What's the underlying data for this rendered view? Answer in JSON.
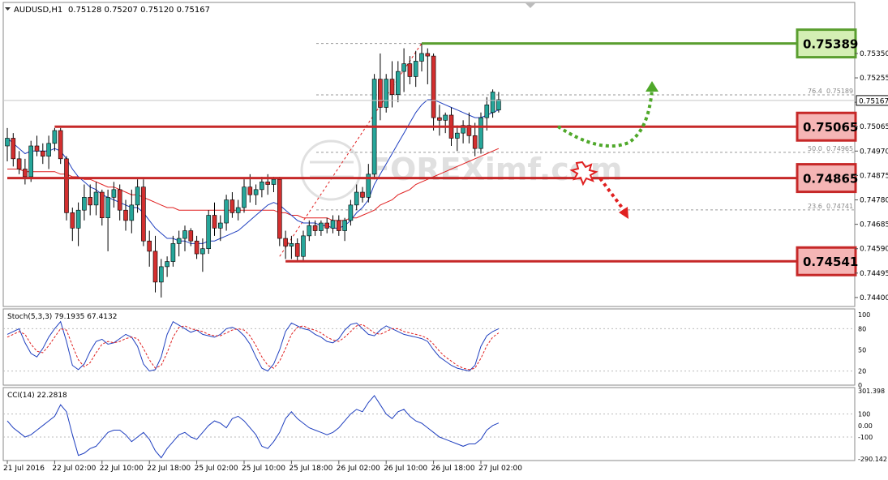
{
  "header": {
    "symbol": "AUDUSD,H1",
    "ohlc": "0.75128 0.75207 0.75120 0.75167"
  },
  "watermark": "FOREXimf.com",
  "colors": {
    "bull": "#26a69a",
    "bear": "#d32f2f",
    "ma_fast": "#1f3fbf",
    "ma_slow": "#e02020",
    "level_red": "#c62828",
    "level_green": "#5a9e2f"
  },
  "price_axis": {
    "ylim": [
      0.74365,
      0.75495
    ],
    "ticks": [
      "0.75350",
      "0.75255",
      "0.75160",
      "0.75065",
      "0.74970",
      "0.74875",
      "0.74780",
      "0.74685",
      "0.74590",
      "0.74495",
      "0.74400"
    ],
    "tick_values": [
      0.7535,
      0.75255,
      0.7516,
      0.75065,
      0.7497,
      0.74875,
      0.7478,
      0.74685,
      0.7459,
      0.74495,
      0.744
    ],
    "current_price": "0.75167"
  },
  "time_axis": {
    "labels": [
      "21 Jul 2016",
      "22 Jul 02:00",
      "22 Jul 10:00",
      "22 Jul 18:00",
      "25 Jul 02:00",
      "25 Jul 10:00",
      "25 Jul 18:00",
      "26 Jul 02:00",
      "26 Jul 10:00",
      "26 Jul 18:00",
      "27 Jul 02:00"
    ],
    "label_index": [
      0,
      8,
      16,
      24,
      32,
      40,
      48,
      56,
      64,
      72,
      80
    ]
  },
  "levels": [
    {
      "label": "0.75389",
      "value": 0.75389,
      "color": "green",
      "start": 70
    },
    {
      "label": "0.75065",
      "value": 0.75065,
      "color": "red",
      "start": 8
    },
    {
      "label": "0.74865",
      "value": 0.74865,
      "color": "red",
      "start": 0
    },
    {
      "label": "0.74541",
      "value": 0.74541,
      "color": "red",
      "start": 47
    }
  ],
  "fib": [
    {
      "label": "76.4",
      "value": "0.75189",
      "level": 0.75189
    },
    {
      "label": "50.0",
      "value": "0.74965",
      "level": 0.74965
    },
    {
      "label": "23.6",
      "value": "0.74741",
      "level": 0.74741
    }
  ],
  "chart_data": {
    "type": "candlestick",
    "ylim": [
      0.74365,
      0.75495
    ],
    "candles": [
      [
        0.7499,
        0.7506,
        0.7493,
        0.7502
      ],
      [
        0.7502,
        0.7504,
        0.7491,
        0.7494
      ],
      [
        0.7494,
        0.7497,
        0.7488,
        0.749
      ],
      [
        0.749,
        0.7494,
        0.7484,
        0.7487
      ],
      [
        0.7487,
        0.7501,
        0.7485,
        0.7499
      ],
      [
        0.7499,
        0.7503,
        0.7495,
        0.7497
      ],
      [
        0.7497,
        0.75,
        0.7492,
        0.7495
      ],
      [
        0.7495,
        0.7503,
        0.749,
        0.75
      ],
      [
        0.75,
        0.7506,
        0.7497,
        0.7505
      ],
      [
        0.7505,
        0.7506,
        0.7492,
        0.7494
      ],
      [
        0.7494,
        0.7495,
        0.747,
        0.7473
      ],
      [
        0.7473,
        0.7475,
        0.7462,
        0.7467
      ],
      [
        0.7467,
        0.7477,
        0.746,
        0.7474
      ],
      [
        0.7474,
        0.7484,
        0.747,
        0.7479
      ],
      [
        0.7479,
        0.7484,
        0.7472,
        0.7476
      ],
      [
        0.7476,
        0.7485,
        0.7472,
        0.7481
      ],
      [
        0.7481,
        0.7482,
        0.7468,
        0.7471
      ],
      [
        0.7471,
        0.7482,
        0.7458,
        0.7479
      ],
      [
        0.7479,
        0.7485,
        0.7475,
        0.7482
      ],
      [
        0.7482,
        0.7484,
        0.747,
        0.7474
      ],
      [
        0.7474,
        0.7478,
        0.7466,
        0.747
      ],
      [
        0.747,
        0.7482,
        0.7465,
        0.7476
      ],
      [
        0.7476,
        0.7486,
        0.7473,
        0.7483
      ],
      [
        0.7483,
        0.7486,
        0.746,
        0.7462
      ],
      [
        0.7462,
        0.7466,
        0.7452,
        0.7458
      ],
      [
        0.7458,
        0.7464,
        0.7442,
        0.7446
      ],
      [
        0.7446,
        0.7455,
        0.744,
        0.7452
      ],
      [
        0.7452,
        0.7456,
        0.7448,
        0.7454
      ],
      [
        0.7454,
        0.7464,
        0.7452,
        0.7461
      ],
      [
        0.7461,
        0.7466,
        0.7456,
        0.7463
      ],
      [
        0.7463,
        0.7468,
        0.7458,
        0.7466
      ],
      [
        0.7466,
        0.7467,
        0.746,
        0.7462
      ],
      [
        0.7462,
        0.7464,
        0.7455,
        0.7457
      ],
      [
        0.7457,
        0.7463,
        0.745,
        0.7459
      ],
      [
        0.7459,
        0.7474,
        0.7457,
        0.7472
      ],
      [
        0.7472,
        0.7477,
        0.7464,
        0.7467
      ],
      [
        0.7467,
        0.7472,
        0.7462,
        0.7469
      ],
      [
        0.7469,
        0.748,
        0.7466,
        0.7478
      ],
      [
        0.7478,
        0.7481,
        0.7471,
        0.7473
      ],
      [
        0.7473,
        0.7478,
        0.747,
        0.7475
      ],
      [
        0.7475,
        0.7486,
        0.7473,
        0.7483
      ],
      [
        0.7483,
        0.7488,
        0.7477,
        0.748
      ],
      [
        0.748,
        0.7484,
        0.7476,
        0.7482
      ],
      [
        0.7482,
        0.7487,
        0.7479,
        0.7485
      ],
      [
        0.7485,
        0.7488,
        0.748,
        0.7484
      ],
      [
        0.7484,
        0.7487,
        0.7481,
        0.7486
      ],
      [
        0.7486,
        0.7487,
        0.746,
        0.7463
      ],
      [
        0.7463,
        0.7466,
        0.7455,
        0.746
      ],
      [
        0.746,
        0.7464,
        0.7455,
        0.7461
      ],
      [
        0.7461,
        0.7463,
        0.7454,
        0.7456
      ],
      [
        0.7456,
        0.7466,
        0.7454,
        0.7464
      ],
      [
        0.7464,
        0.747,
        0.7462,
        0.7468
      ],
      [
        0.7468,
        0.747,
        0.7464,
        0.7466
      ],
      [
        0.7466,
        0.747,
        0.7464,
        0.7469
      ],
      [
        0.7469,
        0.7471,
        0.7465,
        0.7467
      ],
      [
        0.7467,
        0.7472,
        0.7465,
        0.747
      ],
      [
        0.747,
        0.7472,
        0.7464,
        0.7466
      ],
      [
        0.7466,
        0.7471,
        0.7462,
        0.747
      ],
      [
        0.747,
        0.7478,
        0.7468,
        0.7476
      ],
      [
        0.7476,
        0.7484,
        0.7474,
        0.7481
      ],
      [
        0.7481,
        0.7483,
        0.7477,
        0.7479
      ],
      [
        0.7479,
        0.7492,
        0.7477,
        0.7488
      ],
      [
        0.7488,
        0.7527,
        0.7486,
        0.7525
      ],
      [
        0.7525,
        0.7535,
        0.7509,
        0.7514
      ],
      [
        0.7514,
        0.7527,
        0.7512,
        0.7525
      ],
      [
        0.7525,
        0.7532,
        0.7514,
        0.7519
      ],
      [
        0.7519,
        0.7532,
        0.7516,
        0.7528
      ],
      [
        0.7528,
        0.7537,
        0.752,
        0.7531
      ],
      [
        0.7531,
        0.7534,
        0.7523,
        0.7526
      ],
      [
        0.7526,
        0.7536,
        0.7522,
        0.7532
      ],
      [
        0.7532,
        0.7539,
        0.7528,
        0.7535
      ],
      [
        0.7535,
        0.7537,
        0.7523,
        0.7534
      ],
      [
        0.7534,
        0.7535,
        0.7505,
        0.751
      ],
      [
        0.751,
        0.7515,
        0.7503,
        0.7509
      ],
      [
        0.7509,
        0.7512,
        0.7504,
        0.7511
      ],
      [
        0.7511,
        0.7514,
        0.7499,
        0.7502
      ],
      [
        0.7502,
        0.7507,
        0.7497,
        0.7504
      ],
      [
        0.7504,
        0.7509,
        0.75,
        0.7507
      ],
      [
        0.7507,
        0.7512,
        0.75,
        0.7503
      ],
      [
        0.7503,
        0.7508,
        0.7495,
        0.7498
      ],
      [
        0.7498,
        0.7512,
        0.7496,
        0.751
      ],
      [
        0.751,
        0.7518,
        0.7505,
        0.7515
      ],
      [
        0.7512,
        0.7521,
        0.751,
        0.752
      ],
      [
        0.7513,
        0.752,
        0.7512,
        0.7517
      ]
    ],
    "ma_fast": [
      0.7502,
      0.75,
      0.7498,
      0.7496,
      0.7497,
      0.7497,
      0.7497,
      0.7497,
      0.7498,
      0.7497,
      0.7494,
      0.749,
      0.7487,
      0.7485,
      0.7483,
      0.7482,
      0.748,
      0.7479,
      0.7478,
      0.7477,
      0.7476,
      0.7475,
      0.7475,
      0.7473,
      0.747,
      0.7467,
      0.7465,
      0.7463,
      0.7463,
      0.7462,
      0.7462,
      0.7461,
      0.7461,
      0.7461,
      0.7462,
      0.7462,
      0.7463,
      0.7464,
      0.7465,
      0.7466,
      0.7468,
      0.747,
      0.7472,
      0.7474,
      0.7476,
      0.7477,
      0.7476,
      0.7474,
      0.7472,
      0.747,
      0.7469,
      0.7469,
      0.7469,
      0.7468,
      0.7468,
      0.7467,
      0.7467,
      0.7468,
      0.747,
      0.7473,
      0.7475,
      0.7478,
      0.7484,
      0.7488,
      0.7492,
      0.7496,
      0.75,
      0.7504,
      0.7508,
      0.7512,
      0.7515,
      0.7517,
      0.7517,
      0.7516,
      0.7515,
      0.7514,
      0.7513,
      0.7512,
      0.7511,
      0.751,
      0.751,
      0.7511,
      0.7512,
      0.7513
    ],
    "ma_slow": [
      0.749,
      0.749,
      0.749,
      0.7489,
      0.7489,
      0.7489,
      0.7489,
      0.7489,
      0.7489,
      0.7488,
      0.7488,
      0.7487,
      0.7487,
      0.7486,
      0.7486,
      0.7485,
      0.7484,
      0.7483,
      0.7483,
      0.7482,
      0.7481,
      0.748,
      0.748,
      0.7479,
      0.7478,
      0.7477,
      0.7476,
      0.7475,
      0.7475,
      0.7474,
      0.7474,
      0.7474,
      0.7474,
      0.7474,
      0.7474,
      0.7474,
      0.7474,
      0.7474,
      0.7474,
      0.7474,
      0.7474,
      0.7474,
      0.7474,
      0.7474,
      0.7474,
      0.7474,
      0.7473,
      0.7473,
      0.7472,
      0.7472,
      0.7471,
      0.7471,
      0.7471,
      0.7471,
      0.7471,
      0.747,
      0.747,
      0.747,
      0.7471,
      0.7471,
      0.7472,
      0.7473,
      0.7474,
      0.7476,
      0.7477,
      0.7478,
      0.748,
      0.7481,
      0.7482,
      0.7484,
      0.7485,
      0.7486,
      0.7487,
      0.7488,
      0.7489,
      0.749,
      0.7491,
      0.7492,
      0.7493,
      0.7494,
      0.7495,
      0.7496,
      0.7497,
      0.7498
    ]
  },
  "stoch": {
    "label": "Stoch(5,3,3) 79.1935 67.4132",
    "ticks": [
      "100",
      "80",
      "50",
      "20",
      "0"
    ],
    "tick_values": [
      100,
      80,
      50,
      20,
      0
    ],
    "main": [
      72,
      76,
      80,
      60,
      45,
      40,
      52,
      68,
      80,
      90,
      62,
      28,
      22,
      30,
      48,
      62,
      65,
      58,
      60,
      66,
      72,
      68,
      55,
      30,
      20,
      22,
      40,
      72,
      90,
      85,
      80,
      75,
      78,
      72,
      70,
      68,
      72,
      80,
      82,
      78,
      70,
      58,
      40,
      24,
      20,
      30,
      50,
      76,
      88,
      84,
      80,
      78,
      72,
      68,
      62,
      60,
      66,
      78,
      86,
      88,
      80,
      72,
      70,
      78,
      84,
      80,
      76,
      72,
      70,
      68,
      66,
      62,
      50,
      40,
      34,
      28,
      24,
      22,
      20,
      28,
      55,
      70,
      76,
      80
    ],
    "signal": [
      68,
      72,
      76,
      72,
      58,
      48,
      46,
      56,
      68,
      80,
      78,
      56,
      36,
      26,
      32,
      46,
      58,
      62,
      60,
      62,
      66,
      68,
      66,
      52,
      36,
      24,
      28,
      46,
      68,
      82,
      84,
      80,
      78,
      76,
      72,
      70,
      70,
      74,
      78,
      80,
      78,
      70,
      56,
      40,
      28,
      24,
      34,
      52,
      72,
      82,
      84,
      80,
      78,
      74,
      68,
      64,
      62,
      68,
      76,
      84,
      86,
      80,
      74,
      72,
      76,
      80,
      80,
      76,
      74,
      72,
      70,
      66,
      58,
      48,
      40,
      34,
      28,
      24,
      22,
      24,
      38,
      56,
      68,
      74
    ]
  },
  "cci": {
    "label": "CCI(14) 22.2818",
    "ticks": [
      "301.398",
      "100",
      "0.00",
      "-100",
      "-290.142"
    ],
    "tick_values": [
      301.398,
      100,
      0,
      -100,
      -290.142
    ],
    "values": [
      40,
      -20,
      -60,
      -100,
      -80,
      -40,
      0,
      40,
      80,
      180,
      120,
      -80,
      -260,
      -240,
      -200,
      -180,
      -120,
      -60,
      -40,
      -40,
      -80,
      -140,
      -100,
      -60,
      -120,
      -220,
      -280,
      -200,
      -140,
      -80,
      -60,
      -100,
      -120,
      -60,
      0,
      40,
      20,
      -20,
      60,
      80,
      40,
      -20,
      -80,
      -180,
      -200,
      -140,
      -60,
      60,
      120,
      60,
      20,
      -20,
      -40,
      -60,
      -80,
      -60,
      -20,
      40,
      100,
      140,
      120,
      200,
      260,
      180,
      100,
      60,
      120,
      140,
      80,
      40,
      20,
      -20,
      -60,
      -100,
      -120,
      -140,
      -160,
      -180,
      -160,
      -160,
      -120,
      -40,
      0,
      22
    ]
  }
}
